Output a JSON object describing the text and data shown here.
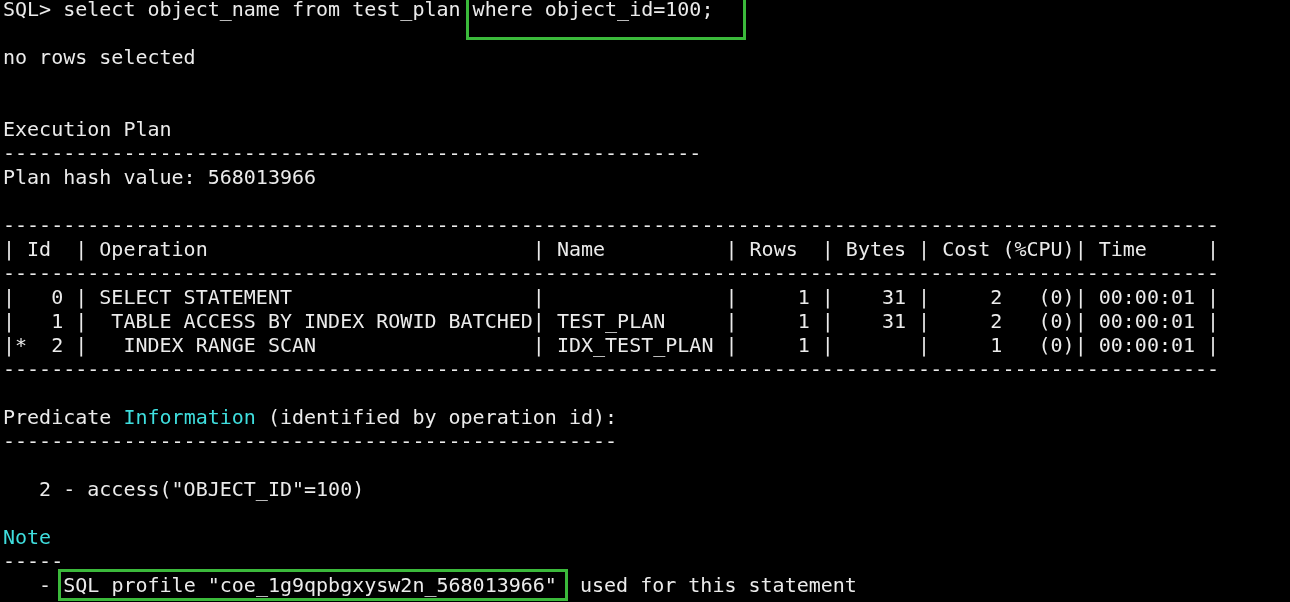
{
  "terminal": {
    "lines": [
      {
        "kind": "text",
        "segments": [
          {
            "kind": "plain",
            "text": "SQL> select object_name from test_plan "
          },
          {
            "kind": "boxed",
            "text": "where object_id=100;"
          }
        ]
      },
      {
        "kind": "blank"
      },
      {
        "kind": "text",
        "segments": [
          {
            "kind": "plain",
            "text": "no rows selected"
          }
        ]
      },
      {
        "kind": "blank"
      },
      {
        "kind": "blank"
      },
      {
        "kind": "text",
        "segments": [
          {
            "kind": "plain",
            "text": "Execution Plan"
          }
        ]
      },
      {
        "kind": "text",
        "segments": [
          {
            "kind": "plain",
            "text": "----------------------------------------------------------"
          }
        ]
      },
      {
        "kind": "text",
        "segments": [
          {
            "kind": "plain",
            "text": "Plan hash value: 568013966"
          }
        ]
      },
      {
        "kind": "blank"
      },
      {
        "kind": "text",
        "segments": [
          {
            "kind": "plain",
            "text": "-----------------------------------------------------------------------------------------------------"
          }
        ]
      },
      {
        "kind": "text",
        "segments": [
          {
            "kind": "plain",
            "text": "| Id  | Operation                           | Name          | Rows  | Bytes | Cost (%CPU)| Time     |"
          }
        ]
      },
      {
        "kind": "text",
        "segments": [
          {
            "kind": "plain",
            "text": "-----------------------------------------------------------------------------------------------------"
          }
        ]
      },
      {
        "kind": "text",
        "segments": [
          {
            "kind": "plain",
            "text": "|   0 | SELECT STATEMENT                    |               |     1 |    31 |     2   (0)| 00:00:01 |"
          }
        ]
      },
      {
        "kind": "text",
        "segments": [
          {
            "kind": "plain",
            "text": "|   1 |  TABLE ACCESS BY INDEX ROWID BATCHED| TEST_PLAN     |     1 |    31 |     2   (0)| 00:00:01 |"
          }
        ]
      },
      {
        "kind": "text",
        "segments": [
          {
            "kind": "plain",
            "text": "|*  2 |   INDEX RANGE SCAN                  | IDX_TEST_PLAN |     1 |       |     1   (0)| 00:00:01 |"
          }
        ]
      },
      {
        "kind": "text",
        "segments": [
          {
            "kind": "plain",
            "text": "-----------------------------------------------------------------------------------------------------"
          }
        ]
      },
      {
        "kind": "blank"
      },
      {
        "kind": "text",
        "segments": [
          {
            "kind": "plain",
            "text": "Predicate "
          },
          {
            "kind": "cyan",
            "text": "Information"
          },
          {
            "kind": "plain",
            "text": " (identified by operation id):"
          }
        ]
      },
      {
        "kind": "text",
        "segments": [
          {
            "kind": "plain",
            "text": "---------------------------------------------------"
          }
        ]
      },
      {
        "kind": "blank"
      },
      {
        "kind": "text",
        "segments": [
          {
            "kind": "plain",
            "text": "   2 - access(\"OBJECT_ID\"=100)"
          }
        ]
      },
      {
        "kind": "blank"
      },
      {
        "kind": "text",
        "segments": [
          {
            "kind": "cyan",
            "text": "Note"
          }
        ]
      },
      {
        "kind": "text",
        "segments": [
          {
            "kind": "plain",
            "text": "-----"
          }
        ]
      },
      {
        "kind": "text",
        "segments": [
          {
            "kind": "plain",
            "text": "   - "
          },
          {
            "kind": "boxed",
            "text": "SQL profile \"coe_1g9qpbgxysw2n_568013966\""
          },
          {
            "kind": "plain",
            "text": " used for this statement"
          }
        ]
      }
    ]
  }
}
